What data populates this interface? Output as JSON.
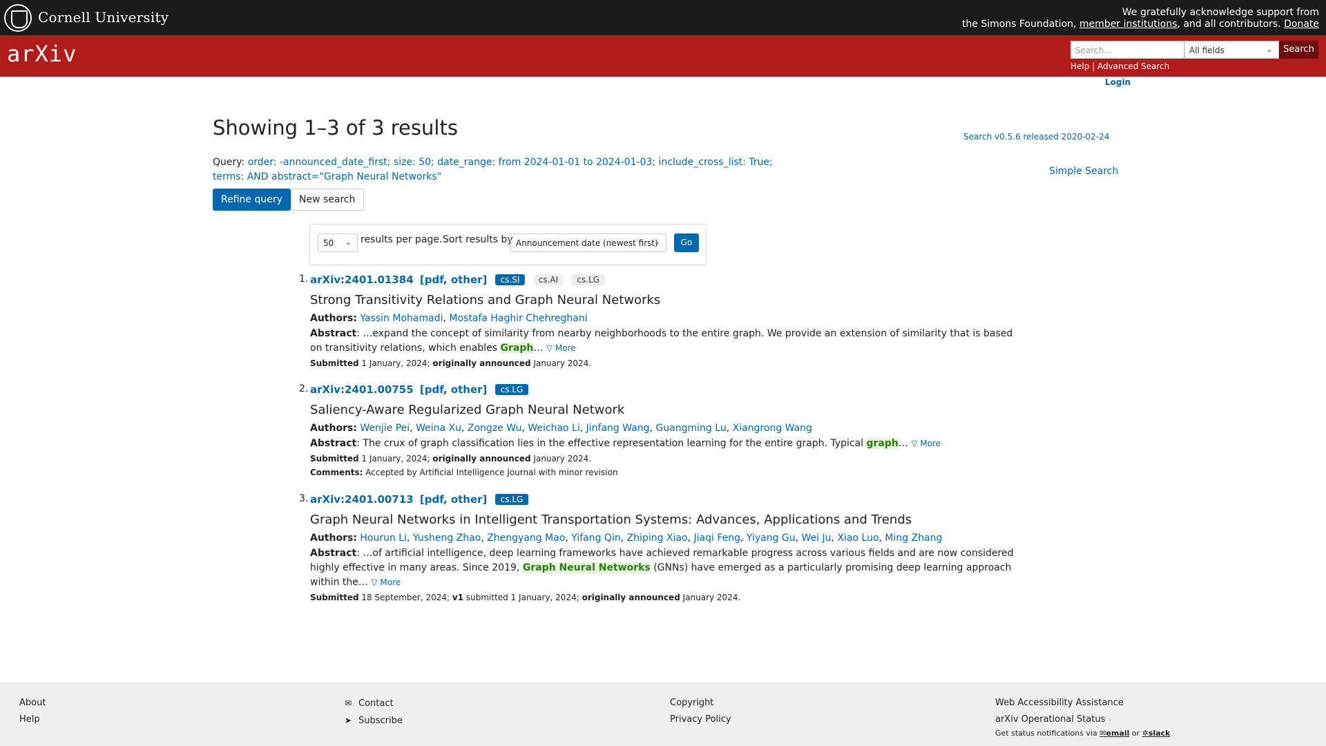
{
  "header": {
    "university": "Cornell University",
    "ack_line1": "We gratefully acknowledge support from",
    "ack_line2_pre": "the Simons Foundation,",
    "ack_member_link": "member institutions",
    "ack_line2_mid": ", and all contributors.",
    "donate": "Donate"
  },
  "nav": {
    "logo": "arXiv",
    "search_placeholder": "Search...",
    "field_select": "All fields",
    "search_button": "Search",
    "help": "Help",
    "separator": "|",
    "advanced": "Advanced Search",
    "login": "Login"
  },
  "main": {
    "title": "Showing 1–3 of 3 results",
    "version": "Search v0.5.6 released 2020-02-24",
    "query_label": "Query:",
    "query_text": "order: -announced_date_first; size: 50; date_range: from 2024-01-01 to 2024-01-03; include_cross_list: True; terms: AND abstract=\"Graph Neural Networks\"",
    "simple_search": "Simple Search",
    "refine": "Refine query",
    "new_search": "New search",
    "per_page_value": "50",
    "per_page_label": "results per page.",
    "sort_label": "Sort results by",
    "sort_value": "Announcement date (newest first)",
    "go": "Go"
  },
  "results": [
    {
      "num": "1.",
      "id": "arXiv:2401.01384",
      "links": "[pdf, other]",
      "tags": [
        "cs.SI",
        "cs.AI",
        "cs.LG"
      ],
      "title": "Strong Transitivity Relations and Graph Neural Networks",
      "authors_label": "Authors:",
      "authors": [
        "Yassin Mohamadi",
        "Mostafa Haghir Chehreghani"
      ],
      "abstract_label": "Abstract",
      "abstract_pre": ": …expand the concept of similarity from nearby neighborhoods to the entire graph. We provide an extension of similarity that is based on transitivity relations, which enables ",
      "abstract_hl": "Graph",
      "abstract_post": "…",
      "more": "▽ More",
      "submitted_label": "Submitted",
      "submitted": "1 January, 2024;",
      "announced_label": "originally announced",
      "announced": "January 2024."
    },
    {
      "num": "2.",
      "id": "arXiv:2401.00755",
      "links": "[pdf, other]",
      "tags": [
        "cs.LG"
      ],
      "title": "Saliency-Aware Regularized Graph Neural Network",
      "authors_label": "Authors:",
      "authors": [
        "Wenjie Pei",
        "Weina Xu",
        "Zongze Wu",
        "Weichao Li",
        "Jinfang Wang",
        "Guangming Lu",
        "Xiangrong Wang"
      ],
      "abstract_label": "Abstract",
      "abstract_pre": ": The crux of graph classification lies in the effective representation learning for the entire graph. Typical ",
      "abstract_hl": "graph",
      "abstract_post": "…",
      "more": "▽ More",
      "submitted_label": "Submitted",
      "submitted": "1 January, 2024;",
      "announced_label": "originally announced",
      "announced": "January 2024.",
      "comments_label": "Comments:",
      "comments": "Accepted by Artificial Intelligence Journal with minor revision"
    },
    {
      "num": "3.",
      "id": "arXiv:2401.00713",
      "links": "[pdf, other]",
      "tags": [
        "cs.LG"
      ],
      "title": "Graph Neural Networks in Intelligent Transportation Systems: Advances, Applications and Trends",
      "authors_label": "Authors:",
      "authors": [
        "Hourun Li",
        "Yusheng Zhao",
        "Zhengyang Mao",
        "Yifang Qin",
        "Zhiping Xiao",
        "Jiaqi Feng",
        "Yiyang Gu",
        "Wei Ju",
        "Xiao Luo",
        "Ming Zhang"
      ],
      "abstract_label": "Abstract",
      "abstract_pre": ": …of artificial intelligence, deep learning frameworks have achieved remarkable progress across various fields and are now considered highly effective in many areas. Since 2019, ",
      "abstract_hl": "Graph Neural Networks",
      "abstract_post": " (GNNs) have emerged as a particularly promising deep learning approach within the…",
      "more": "▽ More",
      "submitted_label": "Submitted",
      "submitted": "18 September, 2024;",
      "v1_label": "v1",
      "v1": "submitted 1 January, 2024;",
      "announced_label": "originally announced",
      "announced": "January 2024."
    }
  ],
  "footer": {
    "about": "About",
    "help": "Help",
    "contact": "Contact",
    "subscribe": "Subscribe",
    "copyright": "Copyright",
    "privacy": "Privacy Policy",
    "accessibility": "Web Accessibility Assistance",
    "status": "arXiv Operational Status",
    "status_note_pre": "Get status notifications via",
    "email": "email",
    "or": "or",
    "slack": "slack"
  },
  "colors": {
    "cornell_bar": "#1b1b1b",
    "arxiv_red": "#b31b1b",
    "link_blue": "#0068ac",
    "highlight_green": "#27810f"
  }
}
